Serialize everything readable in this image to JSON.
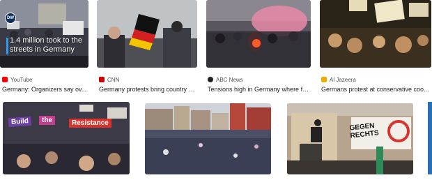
{
  "results": [
    {
      "source": "YouTube",
      "source_icon": "youtube-icon",
      "icon_color": "#ff0000",
      "title": "Germany: Organizers say ov...",
      "overlay_text": "1.4 million took to the streets in Germany",
      "logo_text": "DW"
    },
    {
      "source": "CNN",
      "source_icon": "cnn-icon",
      "icon_color": "#cc0000",
      "title": "Germany protests bring country t..."
    },
    {
      "source": "ABC News",
      "source_icon": "abc-news-icon",
      "icon_color": "#222222",
      "title": "Tensions high in Germany where fa..."
    },
    {
      "source": "Al Jazeera",
      "source_icon": "al-jazeera-icon",
      "icon_color": "#f2a900",
      "title": "Germans protest at conservative coo..."
    }
  ],
  "row2": [
    {
      "signs": [
        "Build",
        "the",
        "Resistance"
      ]
    },
    {},
    {
      "sign": "GEGEN RECHTS"
    }
  ]
}
